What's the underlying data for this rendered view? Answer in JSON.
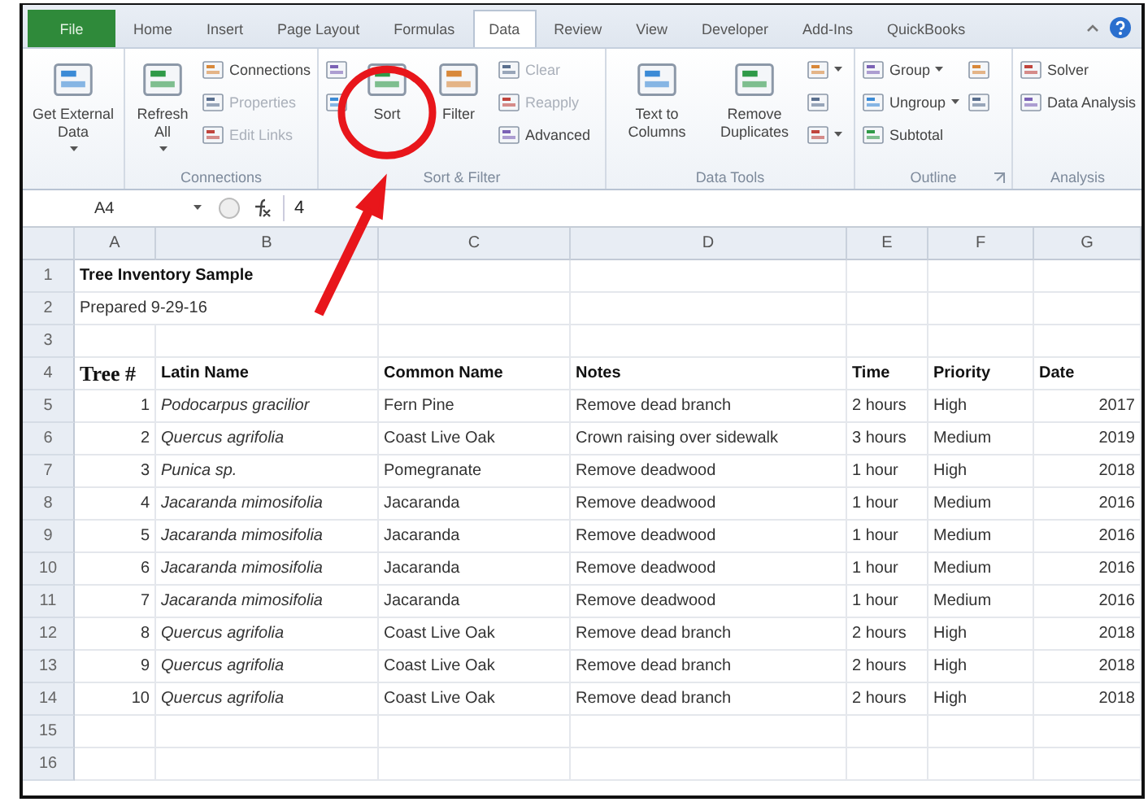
{
  "tabs": [
    {
      "label": "File",
      "kind": "file",
      "selected": false
    },
    {
      "label": "Home",
      "kind": "tab",
      "selected": false
    },
    {
      "label": "Insert",
      "kind": "tab",
      "selected": false
    },
    {
      "label": "Page Layout",
      "kind": "tab",
      "selected": false
    },
    {
      "label": "Formulas",
      "kind": "tab",
      "selected": false
    },
    {
      "label": "Data",
      "kind": "tab",
      "selected": true
    },
    {
      "label": "Review",
      "kind": "tab",
      "selected": false
    },
    {
      "label": "View",
      "kind": "tab",
      "selected": false
    },
    {
      "label": "Developer",
      "kind": "tab",
      "selected": false
    },
    {
      "label": "Add-Ins",
      "kind": "tab",
      "selected": false
    },
    {
      "label": "QuickBooks",
      "kind": "tab",
      "selected": false
    }
  ],
  "ribbon_groups": [
    {
      "columns": [
        {
          "kind": "large",
          "items": [
            {
              "label": "Get External Data",
              "dropdown": true,
              "disabled": false
            }
          ]
        }
      ]
    },
    {
      "label": "Connections",
      "columns": [
        {
          "kind": "large",
          "items": [
            {
              "label": "Refresh All",
              "dropdown": true,
              "disabled": false
            }
          ]
        },
        {
          "kind": "small",
          "items": [
            {
              "label": "Connections",
              "disabled": false
            },
            {
              "label": "Properties",
              "disabled": true
            },
            {
              "label": "Edit Links",
              "disabled": true
            }
          ]
        }
      ]
    },
    {
      "label": "Sort & Filter",
      "columns": [
        {
          "kind": "small",
          "items": [
            {
              "dropdown": false
            },
            {
              "dropdown": false
            }
          ]
        },
        {
          "kind": "large",
          "items": [
            {
              "label": "Sort",
              "disabled": false,
              "circled": true
            },
            {
              "label": "Filter",
              "disabled": false,
              "circled": false
            }
          ]
        },
        {
          "kind": "small",
          "items": [
            {
              "label": "Clear",
              "disabled": true
            },
            {
              "label": "Reapply",
              "disabled": true
            },
            {
              "label": "Advanced",
              "disabled": false
            }
          ]
        }
      ]
    },
    {
      "label": "Data Tools",
      "columns": [
        {
          "kind": "large",
          "items": [
            {
              "label": "Text to Columns",
              "disabled": false
            },
            {
              "label": "Remove Duplicates",
              "disabled": false
            }
          ]
        },
        {
          "kind": "small",
          "items": [
            {
              "dropdown": true
            },
            {
              "dropdown": false
            },
            {
              "dropdown": true
            }
          ]
        }
      ]
    },
    {
      "label": "Outline",
      "launcher": true,
      "columns": [
        {
          "kind": "small",
          "items": [
            {
              "label": "Group",
              "dropdown": true,
              "disabled": false
            },
            {
              "label": "Ungroup",
              "dropdown": true,
              "disabled": false
            },
            {
              "label": "Subtotal",
              "disabled": false
            }
          ]
        },
        {
          "kind": "small",
          "items": [
            {
              "dropdown": false
            },
            {
              "dropdown": false
            }
          ]
        }
      ]
    },
    {
      "label": "Analysis",
      "columns": [
        {
          "kind": "small",
          "items": [
            {
              "label": "Solver",
              "disabled": false
            },
            {
              "label": "Data Analysis",
              "disabled": false
            }
          ]
        }
      ]
    }
  ],
  "formula_bar": {
    "name_box": "A4",
    "formula": "4"
  },
  "columns": [
    "A",
    "B",
    "C",
    "D",
    "E",
    "F",
    "G"
  ],
  "rows": [
    {
      "number": "1",
      "kind": "title",
      "text": "Tree Inventory Sample"
    },
    {
      "number": "2",
      "kind": "note",
      "text": "Prepared 9-29-16"
    },
    {
      "number": "3",
      "kind": "blank"
    },
    {
      "number": "4",
      "kind": "header",
      "cells": [
        "Tree #",
        "Latin Name",
        "Common Name",
        "Notes",
        "Time",
        "Priority",
        "Date"
      ]
    },
    {
      "number": "5",
      "kind": "data",
      "cells": [
        "1",
        "Podocarpus gracilior",
        "Fern Pine",
        "Remove dead branch",
        "2 hours",
        "High",
        "2017"
      ]
    },
    {
      "number": "6",
      "kind": "data",
      "cells": [
        "2",
        "Quercus agrifolia",
        "Coast Live Oak",
        "Crown raising over sidewalk",
        "3 hours",
        "Medium",
        "2019"
      ]
    },
    {
      "number": "7",
      "kind": "data",
      "cells": [
        "3",
        "Punica sp.",
        "Pomegranate",
        "Remove deadwood",
        "1 hour",
        "High",
        "2018"
      ]
    },
    {
      "number": "8",
      "kind": "data",
      "cells": [
        "4",
        "Jacaranda mimosifolia",
        "Jacaranda",
        "Remove deadwood",
        "1 hour",
        "Medium",
        "2016"
      ]
    },
    {
      "number": "9",
      "kind": "data",
      "cells": [
        "5",
        "Jacaranda mimosifolia",
        "Jacaranda",
        "Remove deadwood",
        "1 hour",
        "Medium",
        "2016"
      ]
    },
    {
      "number": "10",
      "kind": "data",
      "cells": [
        "6",
        "Jacaranda mimosifolia",
        "Jacaranda",
        "Remove deadwood",
        "1 hour",
        "Medium",
        "2016"
      ]
    },
    {
      "number": "11",
      "kind": "data",
      "cells": [
        "7",
        "Jacaranda mimosifolia",
        "Jacaranda",
        "Remove deadwood",
        "1 hour",
        "Medium",
        "2016"
      ]
    },
    {
      "number": "12",
      "kind": "data",
      "cells": [
        "8",
        "Quercus agrifolia",
        "Coast Live Oak",
        "Remove dead branch",
        "2 hours",
        "High",
        "2018"
      ]
    },
    {
      "number": "13",
      "kind": "data",
      "cells": [
        "9",
        "Quercus agrifolia",
        "Coast Live Oak",
        "Remove dead branch",
        "2 hours",
        "High",
        "2018"
      ]
    },
    {
      "number": "14",
      "kind": "data",
      "cells": [
        "10",
        "Quercus agrifolia",
        "Coast Live Oak",
        "Remove dead branch",
        "2 hours",
        "High",
        "2018"
      ]
    },
    {
      "number": "15",
      "kind": "blank"
    },
    {
      "number": "16",
      "kind": "blank"
    }
  ]
}
